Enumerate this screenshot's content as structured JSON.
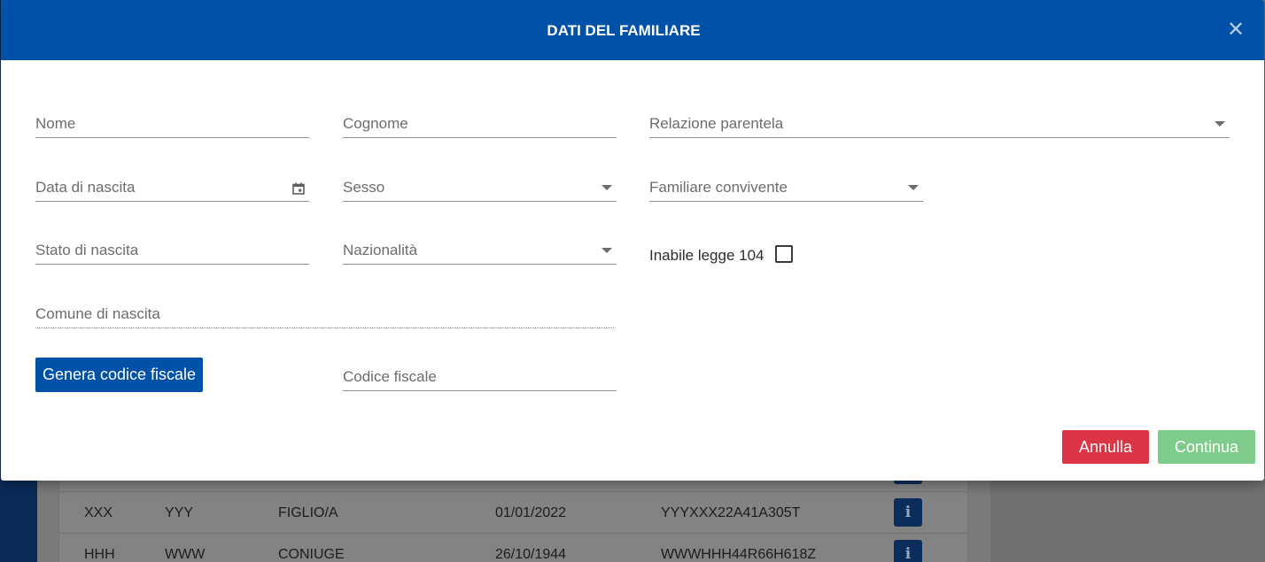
{
  "modal": {
    "title": "DATI DEL FAMILIARE",
    "close_icon": "close-icon",
    "colors": {
      "header": "#0051a8",
      "primary": "#0051a8",
      "danger": "#dc3545",
      "success_disabled": "#7fcb8b"
    },
    "fields": {
      "nome": "Nome",
      "cognome": "Cognome",
      "relazione_parentela": "Relazione parentela",
      "data_nascita": "Data di nascita",
      "sesso": "Sesso",
      "familiare_convivente": "Familiare convivente",
      "stato_nascita": "Stato di nascita",
      "nazionalita": "Nazionalità",
      "comune_nascita": "Comune di nascita",
      "codice_fiscale": "Codice fiscale"
    },
    "checkbox": {
      "label": "Inabile legge 104",
      "checked": false
    },
    "buttons": {
      "genera": "Genera codice fiscale",
      "annulla": "Annulla",
      "continua": "Continua"
    }
  },
  "background_table": {
    "rows": [
      {
        "nome": "XXX",
        "cognome": "YYY",
        "relazione": "FIGLIO/A",
        "data_nascita": "01/01/2022",
        "codice_fiscale": "YYYXXX22A41A305T",
        "action_icon": "info-icon"
      },
      {
        "nome": "HHH",
        "cognome": "WWW",
        "relazione": "CONIUGE",
        "data_nascita": "26/10/1944",
        "codice_fiscale": "WWWHHH44R66H618Z",
        "action_icon": "info-icon"
      }
    ]
  }
}
